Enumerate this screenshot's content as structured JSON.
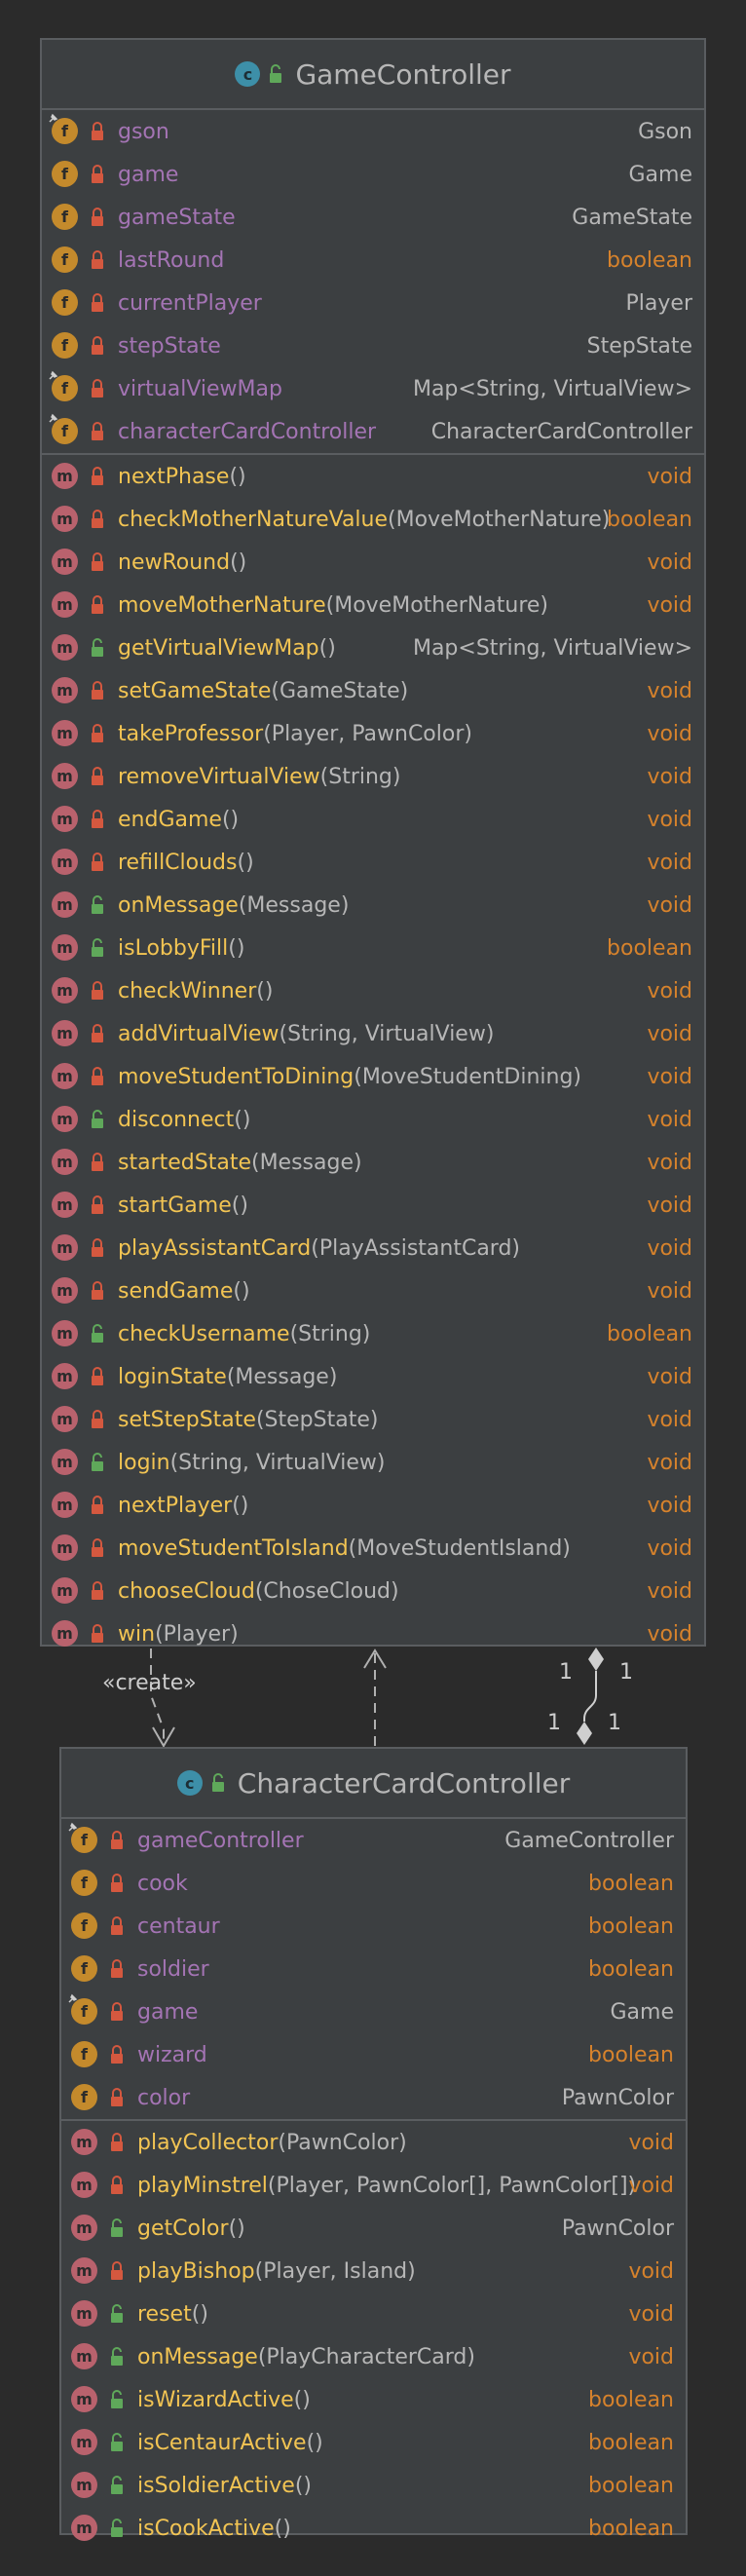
{
  "colors": {
    "background": "#2b2b2b",
    "panel": "#3c3f41",
    "border": "#5a5d60",
    "field_badge": "#c48a2c",
    "method_badge": "#b9626d",
    "class_badge": "#3d8fa8",
    "private_lock": "#d4583f",
    "public_lock": "#5fa85a",
    "field_name": "#a474b4",
    "method_name": "#f2c453",
    "keyword_type": "#d6822c",
    "plain_text": "#b7b7b7"
  },
  "icons": {
    "field": "f",
    "method": "m",
    "class": "c"
  },
  "game_controller": {
    "name": "GameController",
    "fields": [
      {
        "name": "gson",
        "type": "Gson",
        "keyword_type": false,
        "pinned": true,
        "lock": "private"
      },
      {
        "name": "game",
        "type": "Game",
        "keyword_type": false,
        "pinned": false,
        "lock": "private"
      },
      {
        "name": "gameState",
        "type": "GameState",
        "keyword_type": false,
        "pinned": false,
        "lock": "private"
      },
      {
        "name": "lastRound",
        "type": "boolean",
        "keyword_type": true,
        "pinned": false,
        "lock": "private"
      },
      {
        "name": "currentPlayer",
        "type": "Player",
        "keyword_type": false,
        "pinned": false,
        "lock": "private"
      },
      {
        "name": "stepState",
        "type": "StepState",
        "keyword_type": false,
        "pinned": false,
        "lock": "private"
      },
      {
        "name": "virtualViewMap",
        "type": "Map<String, VirtualView>",
        "keyword_type": false,
        "pinned": true,
        "lock": "private"
      },
      {
        "name": "characterCardController",
        "type": "CharacterCardController",
        "keyword_type": false,
        "pinned": true,
        "lock": "private"
      }
    ],
    "methods": [
      {
        "name": "nextPhase",
        "params": "()",
        "type": "void",
        "keyword_type": true,
        "lock": "private"
      },
      {
        "name": "checkMotherNatureValue",
        "params": "(MoveMotherNature)",
        "type": "boolean",
        "keyword_type": true,
        "lock": "private"
      },
      {
        "name": "newRound",
        "params": "()",
        "type": "void",
        "keyword_type": true,
        "lock": "private"
      },
      {
        "name": "moveMotherNature",
        "params": "(MoveMotherNature)",
        "type": "void",
        "keyword_type": true,
        "lock": "private"
      },
      {
        "name": "getVirtualViewMap",
        "params": "()",
        "type": "Map<String, VirtualView>",
        "keyword_type": false,
        "lock": "public"
      },
      {
        "name": "setGameState",
        "params": "(GameState)",
        "type": "void",
        "keyword_type": true,
        "lock": "private"
      },
      {
        "name": "takeProfessor",
        "params": "(Player, PawnColor)",
        "type": "void",
        "keyword_type": true,
        "lock": "private"
      },
      {
        "name": "removeVirtualView",
        "params": "(String)",
        "type": "void",
        "keyword_type": true,
        "lock": "private"
      },
      {
        "name": "endGame",
        "params": "()",
        "type": "void",
        "keyword_type": true,
        "lock": "private"
      },
      {
        "name": "refillClouds",
        "params": "()",
        "type": "void",
        "keyword_type": true,
        "lock": "private"
      },
      {
        "name": "onMessage",
        "params": "(Message)",
        "type": "void",
        "keyword_type": true,
        "lock": "public"
      },
      {
        "name": "isLobbyFill",
        "params": "()",
        "type": "boolean",
        "keyword_type": true,
        "lock": "public"
      },
      {
        "name": "checkWinner",
        "params": "()",
        "type": "void",
        "keyword_type": true,
        "lock": "private"
      },
      {
        "name": "addVirtualView",
        "params": "(String, VirtualView)",
        "type": "void",
        "keyword_type": true,
        "lock": "private"
      },
      {
        "name": "moveStudentToDining",
        "params": "(MoveStudentDining)",
        "type": "void",
        "keyword_type": true,
        "lock": "private"
      },
      {
        "name": "disconnect",
        "params": "()",
        "type": "void",
        "keyword_type": true,
        "lock": "public"
      },
      {
        "name": "startedState",
        "params": "(Message)",
        "type": "void",
        "keyword_type": true,
        "lock": "private"
      },
      {
        "name": "startGame",
        "params": "()",
        "type": "void",
        "keyword_type": true,
        "lock": "private"
      },
      {
        "name": "playAssistantCard",
        "params": "(PlayAssistantCard)",
        "type": "void",
        "keyword_type": true,
        "lock": "private"
      },
      {
        "name": "sendGame",
        "params": "()",
        "type": "void",
        "keyword_type": true,
        "lock": "private"
      },
      {
        "name": "checkUsername",
        "params": "(String)",
        "type": "boolean",
        "keyword_type": true,
        "lock": "public"
      },
      {
        "name": "loginState",
        "params": "(Message)",
        "type": "void",
        "keyword_type": true,
        "lock": "private"
      },
      {
        "name": "setStepState",
        "params": "(StepState)",
        "type": "void",
        "keyword_type": true,
        "lock": "private"
      },
      {
        "name": "login",
        "params": "(String, VirtualView)",
        "type": "void",
        "keyword_type": true,
        "lock": "public"
      },
      {
        "name": "nextPlayer",
        "params": "()",
        "type": "void",
        "keyword_type": true,
        "lock": "private"
      },
      {
        "name": "moveStudentToIsland",
        "params": "(MoveStudentIsland)",
        "type": "void",
        "keyword_type": true,
        "lock": "private"
      },
      {
        "name": "chooseCloud",
        "params": "(ChoseCloud)",
        "type": "void",
        "keyword_type": true,
        "lock": "private"
      },
      {
        "name": "win",
        "params": "(Player)",
        "type": "void",
        "keyword_type": true,
        "lock": "private"
      }
    ]
  },
  "character_card_controller": {
    "name": "CharacterCardController",
    "fields": [
      {
        "name": "gameController",
        "type": "GameController",
        "keyword_type": false,
        "pinned": true,
        "lock": "private"
      },
      {
        "name": "cook",
        "type": "boolean",
        "keyword_type": true,
        "pinned": false,
        "lock": "private"
      },
      {
        "name": "centaur",
        "type": "boolean",
        "keyword_type": true,
        "pinned": false,
        "lock": "private"
      },
      {
        "name": "soldier",
        "type": "boolean",
        "keyword_type": true,
        "pinned": false,
        "lock": "private"
      },
      {
        "name": "game",
        "type": "Game",
        "keyword_type": false,
        "pinned": true,
        "lock": "private"
      },
      {
        "name": "wizard",
        "type": "boolean",
        "keyword_type": true,
        "pinned": false,
        "lock": "private"
      },
      {
        "name": "color",
        "type": "PawnColor",
        "keyword_type": false,
        "pinned": false,
        "lock": "private"
      }
    ],
    "methods": [
      {
        "name": "playCollector",
        "params": "(PawnColor)",
        "type": "void",
        "keyword_type": true,
        "lock": "private"
      },
      {
        "name": "playMinstrel",
        "params": "(Player, PawnColor[], PawnColor[])",
        "type": "void",
        "keyword_type": true,
        "lock": "private"
      },
      {
        "name": "getColor",
        "params": "()",
        "type": "PawnColor",
        "keyword_type": false,
        "lock": "public"
      },
      {
        "name": "playBishop",
        "params": "(Player, Island)",
        "type": "void",
        "keyword_type": true,
        "lock": "private"
      },
      {
        "name": "reset",
        "params": "()",
        "type": "void",
        "keyword_type": true,
        "lock": "public"
      },
      {
        "name": "onMessage",
        "params": "(PlayCharacterCard)",
        "type": "void",
        "keyword_type": true,
        "lock": "public"
      },
      {
        "name": "isWizardActive",
        "params": "()",
        "type": "boolean",
        "keyword_type": true,
        "lock": "public"
      },
      {
        "name": "isCentaurActive",
        "params": "()",
        "type": "boolean",
        "keyword_type": true,
        "lock": "public"
      },
      {
        "name": "isSoldierActive",
        "params": "()",
        "type": "boolean",
        "keyword_type": true,
        "lock": "public"
      },
      {
        "name": "isCookActive",
        "params": "()",
        "type": "boolean",
        "keyword_type": true,
        "lock": "public"
      }
    ]
  },
  "relations": {
    "create_label": "«create»",
    "multiplicity": [
      "1",
      "1",
      "1",
      "1"
    ]
  }
}
